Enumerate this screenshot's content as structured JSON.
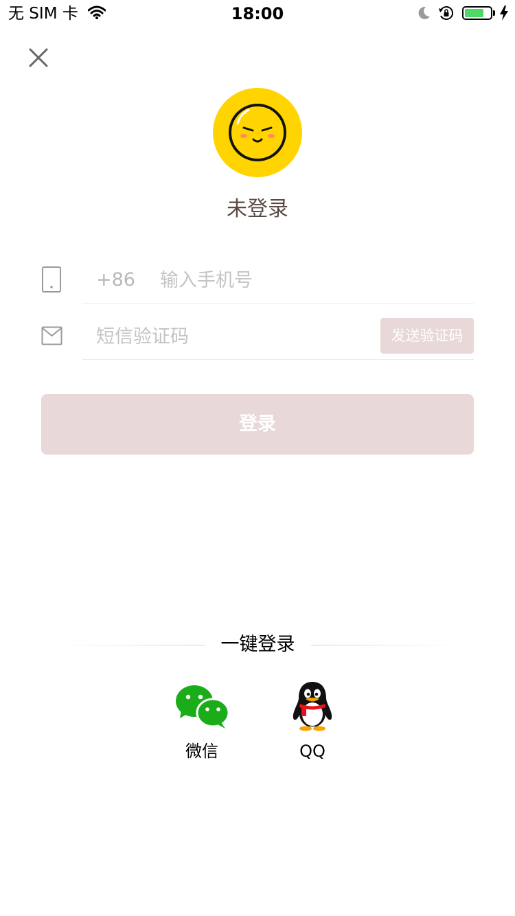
{
  "status_bar": {
    "carrier": "无 SIM 卡",
    "time": "18:00",
    "battery_level": 0.75,
    "icons": [
      "wifi-icon",
      "moon-icon",
      "orientation-lock-icon",
      "battery-icon",
      "charging-bolt-icon"
    ]
  },
  "header": {
    "close_icon": "close-icon"
  },
  "profile": {
    "status_text": "未登录",
    "avatar_icon": "smiley-avatar-icon",
    "avatar_color": "#ffd400"
  },
  "form": {
    "phone": {
      "icon": "phone-icon",
      "country_code": "+86",
      "placeholder": "输入手机号",
      "value": ""
    },
    "code": {
      "icon": "envelope-icon",
      "placeholder": "短信验证码",
      "value": "",
      "send_label": "发送验证码"
    },
    "login_label": "登录",
    "button_color": "#e8d8d8"
  },
  "quick_login": {
    "title": "一键登录",
    "providers": [
      {
        "label": "微信",
        "icon": "wechat-icon",
        "color": "#1aad19"
      },
      {
        "label": "QQ",
        "icon": "qq-penguin-icon",
        "color": "#000000"
      }
    ]
  }
}
